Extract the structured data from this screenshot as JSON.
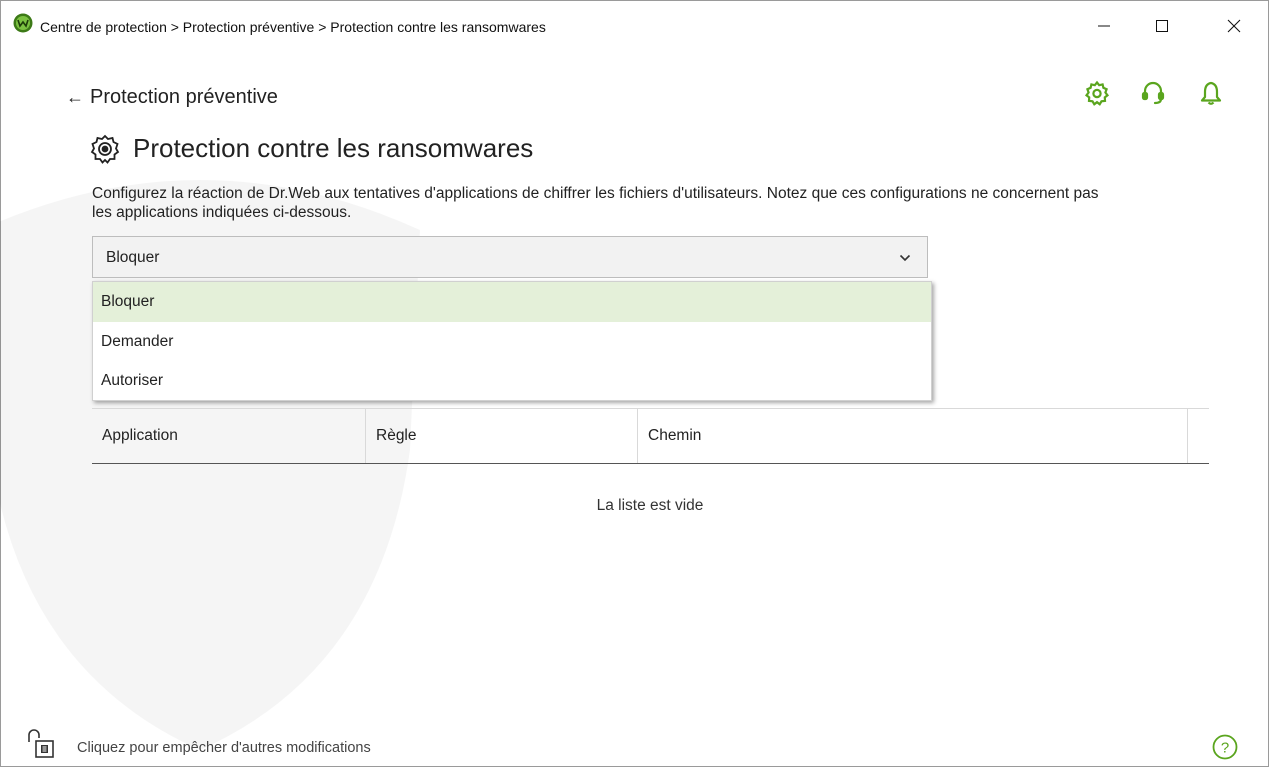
{
  "window": {
    "title": "Centre de protection > Protection préventive > Protection contre les ransomwares"
  },
  "toolbar": {
    "icons": [
      "settings-icon",
      "support-icon",
      "notifications-icon"
    ]
  },
  "nav": {
    "back_label": "Protection préventive",
    "back_arrow": "←"
  },
  "page": {
    "title": "Protection contre les ransomwares",
    "description": "Configurez la réaction de Dr.Web aux tentatives d'applications de chiffrer les fichiers d'utilisateurs. Notez que ces configurations ne concernent pas les applications indiquées ci-dessous."
  },
  "reaction_select": {
    "value": "Bloquer",
    "options": [
      "Bloquer",
      "Demander",
      "Autoriser"
    ],
    "selected_index": 0
  },
  "table": {
    "columns": [
      "Application",
      "Règle",
      "Chemin"
    ],
    "rows": [],
    "empty_text": "La liste est vide"
  },
  "footer": {
    "lock_text": "Cliquez pour empêcher d'autres modifications"
  },
  "colors": {
    "accent_green": "#5aa51e",
    "selected_option_bg": "#e4f0d9"
  }
}
